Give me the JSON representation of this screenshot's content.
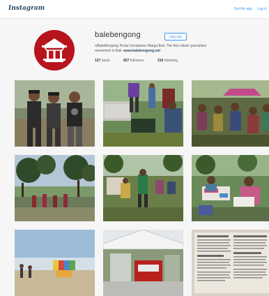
{
  "header": {
    "logo": "Instagram",
    "get_app": "Get the app",
    "login": "Log in"
  },
  "profile": {
    "username": "balebengong",
    "follow_label": "FOLLOW",
    "bio_line1": "n/BaleBengong Portal Jurnalisme Warga Bali. The first citizen journalism",
    "bio_line2_prefix": "movement in Bali.",
    "website": "www.balebengong.net",
    "posts_count": "127",
    "posts_label": "posts",
    "followers_count": "827",
    "followers_label": "followers",
    "following_count": "310",
    "following_label": "following"
  },
  "colors": {
    "avatar_bg": "#b8141b",
    "link": "#3897f0"
  },
  "grid": {
    "tiles": [
      {
        "name": "photo-three-men"
      },
      {
        "name": "photo-outdoor-event"
      },
      {
        "name": "photo-crowd-tents"
      },
      {
        "name": "photo-beach-performance"
      },
      {
        "name": "photo-park-gathering"
      },
      {
        "name": "photo-workshop-table"
      },
      {
        "name": "photo-jazz-sign-beach"
      },
      {
        "name": "photo-tent-booth"
      },
      {
        "name": "photo-document-text"
      }
    ]
  }
}
